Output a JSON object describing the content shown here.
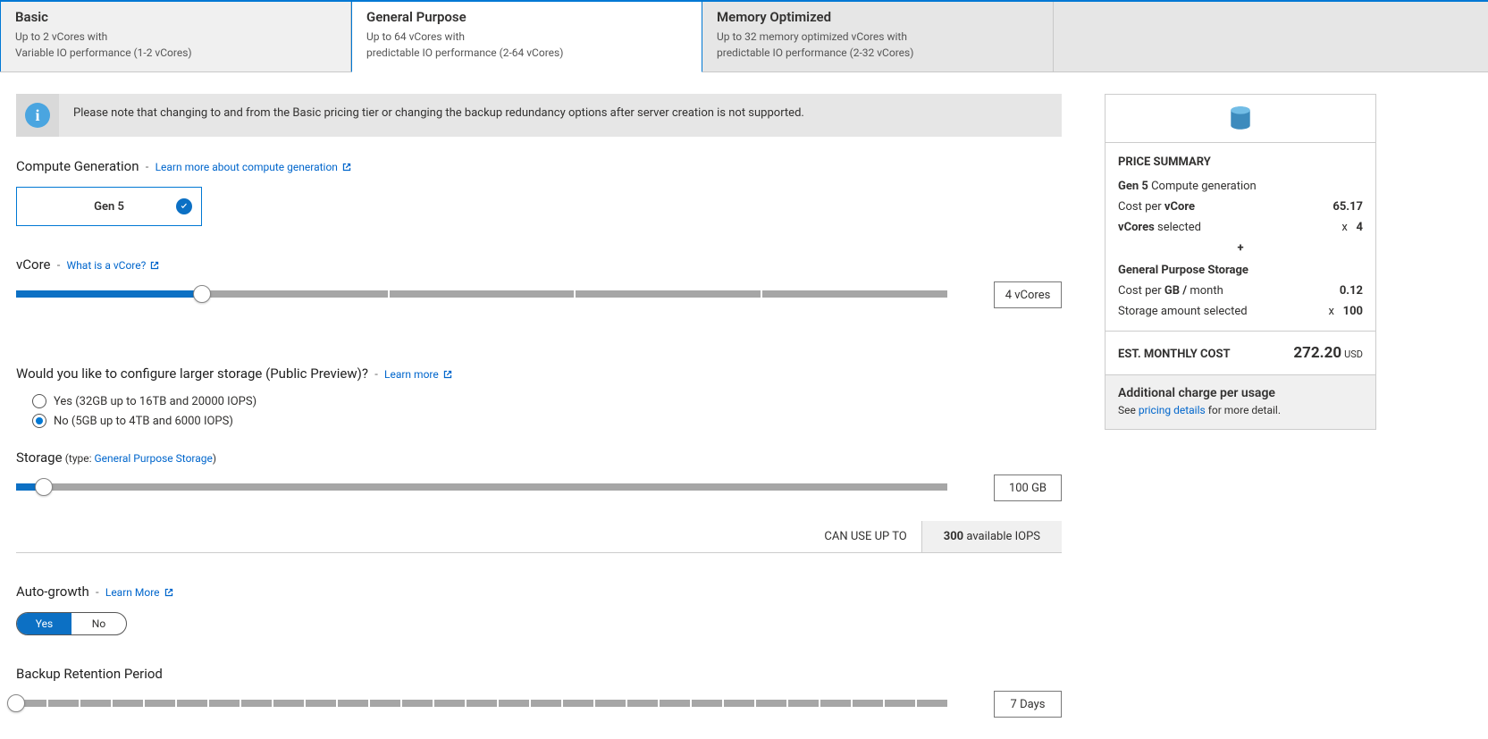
{
  "tabs": {
    "basic": {
      "title": "Basic",
      "line1": "Up to 2 vCores with",
      "line2": "Variable IO performance (1-2 vCores)"
    },
    "general": {
      "title": "General Purpose",
      "line1": "Up to 64 vCores with",
      "line2": "predictable IO performance (2-64 vCores)"
    },
    "memory": {
      "title": "Memory Optimized",
      "line1": "Up to 32 memory optimized vCores with",
      "line2": "predictable IO performance (2-32 vCores)"
    }
  },
  "banner": {
    "text": "Please note that changing to and from the Basic pricing tier or changing the backup redundancy options after server creation is not supported."
  },
  "compute_gen": {
    "label": "Compute Generation",
    "link": "Learn more about compute generation",
    "selected": "Gen 5"
  },
  "vcore": {
    "label": "vCore",
    "link": "What is a vCore?",
    "value": "4 vCores",
    "filled_segments": 1,
    "total_segments": 5,
    "thumb_pct": 20
  },
  "larger_storage": {
    "label": "Would you like to configure larger storage (Public Preview)?",
    "link": "Learn more",
    "options": {
      "yes": "Yes (32GB up to 16TB and 20000 IOPS)",
      "no": "No (5GB up to 4TB and 6000 IOPS)"
    },
    "selected": "no"
  },
  "storage": {
    "label": "Storage",
    "type_prefix": "(type:",
    "type_link": "General Purpose Storage",
    "type_suffix": ")",
    "value": "100 GB",
    "thumb_pct": 3
  },
  "iops": {
    "label": "CAN USE UP TO",
    "value": "300",
    "suffix": "available IOPS"
  },
  "autogrowth": {
    "label": "Auto-growth",
    "link": "Learn More",
    "on": "Yes",
    "off": "No"
  },
  "backup": {
    "label": "Backup Retention Period",
    "value": "7 Days",
    "segments": 29,
    "thumb_pct": 0
  },
  "summary": {
    "title": "PRICE SUMMARY",
    "gen_label_bold": "Gen 5",
    "gen_label_rest": "Compute generation",
    "cost_vcore_label_pre": "Cost per ",
    "cost_vcore_label_bold": "vCore",
    "cost_vcore_value": "65.17",
    "vcores_selected_label_bold": "vCores",
    "vcores_selected_label_rest": "selected",
    "vcores_selected_mult": "x",
    "vcores_selected_value": "4",
    "storage_heading": "General Purpose Storage",
    "cost_gb_label_pre": "Cost per ",
    "cost_gb_label_bold": "GB /",
    "cost_gb_label_post": "month",
    "cost_gb_value": "0.12",
    "storage_sel_label": "Storage amount selected",
    "storage_sel_mult": "x",
    "storage_sel_value": "100",
    "total_label": "EST. MONTHLY COST",
    "total_value": "272.20",
    "total_currency": "USD",
    "addl_heading": "Additional charge per usage",
    "addl_pre": "See ",
    "addl_link": "pricing details",
    "addl_post": " for more detail."
  }
}
